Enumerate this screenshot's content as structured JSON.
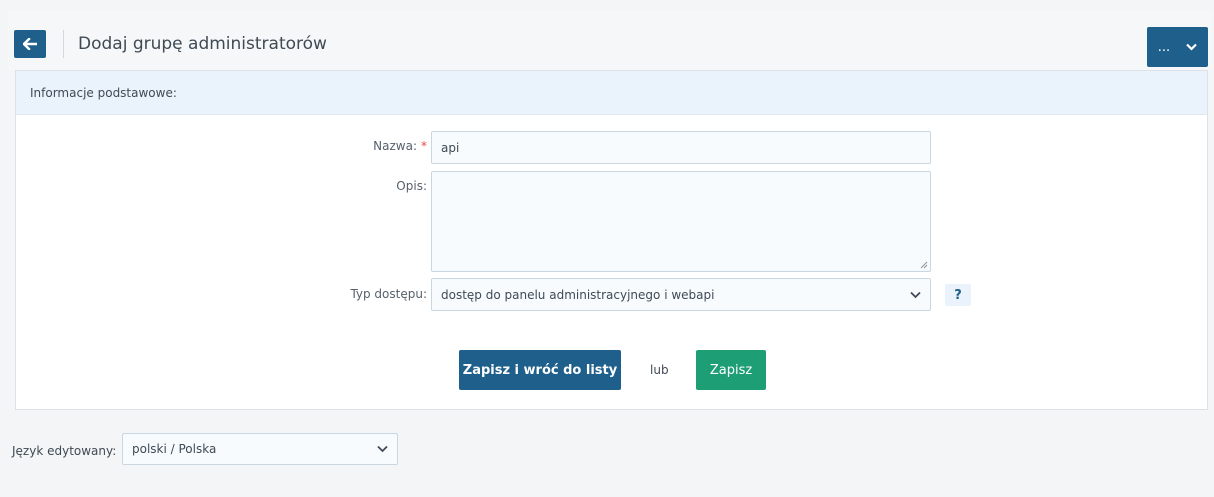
{
  "header": {
    "title": "Dodaj grupę administratorów",
    "more_label": "..."
  },
  "panel": {
    "heading": "Informacje podstawowe:"
  },
  "form": {
    "name_label": "Nazwa:",
    "name_required": "*",
    "name_value": "api",
    "description_label": "Opis:",
    "description_value": "",
    "access_label": "Typ dostępu:",
    "access_selected": "dostęp do panelu administracyjnego i webapi",
    "help_label": "?"
  },
  "actions": {
    "save_and_return": "Zapisz i wróć do listy",
    "or": "lub",
    "save": "Zapisz"
  },
  "language": {
    "label": "Język edytowany:",
    "selected": "polski / Polska"
  },
  "colors": {
    "primary": "#1f5f8b",
    "success": "#1e9e74",
    "panel_header": "#eaf3fb",
    "required": "#e84a4a"
  },
  "icons": {
    "back": "arrow-left-icon",
    "more": "chevron-down-icon",
    "select": "chevron-down-icon",
    "resize": "resize-grip-icon"
  }
}
